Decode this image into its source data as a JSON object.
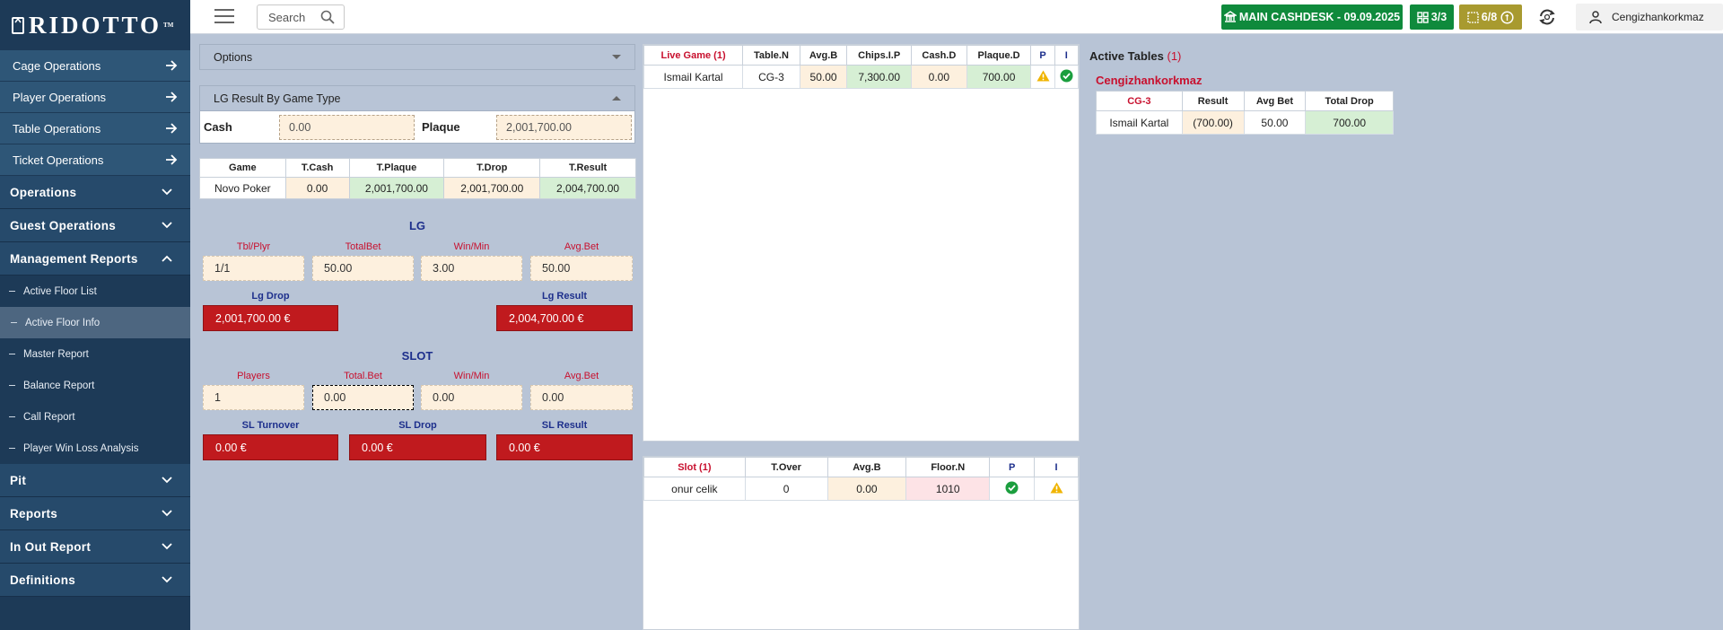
{
  "brand": {
    "name": "RIDOTTO",
    "tm": "TM"
  },
  "sidebar": {
    "sub_ops": [
      {
        "label": "Cage Operations"
      },
      {
        "label": "Player Operations"
      },
      {
        "label": "Table Operations"
      },
      {
        "label": "Ticket Operations"
      }
    ],
    "groups_top": [
      {
        "label": "Operations"
      },
      {
        "label": "Guest Operations"
      },
      {
        "label": "Management Reports"
      }
    ],
    "mgmt_items": [
      {
        "label": "Active Floor List"
      },
      {
        "label": "Active Floor Info"
      },
      {
        "label": "Master Report"
      },
      {
        "label": "Balance Report"
      },
      {
        "label": "Call Report"
      },
      {
        "label": "Player Win Loss Analysis"
      }
    ],
    "groups_bottom": [
      {
        "label": "Pit"
      },
      {
        "label": "Reports"
      },
      {
        "label": "In Out Report"
      },
      {
        "label": "Definitions"
      }
    ]
  },
  "topbar": {
    "search_placeholder": "Search",
    "cashdesk": "MAIN CASHDESK - 09.09.2025",
    "tables_badge": "3/3",
    "slots_badge": "6/8",
    "username": "Cengizhankorkmaz"
  },
  "options": {
    "label": "Options"
  },
  "lg_by_type": {
    "label": "LG Result By Game Type",
    "cash_label": "Cash",
    "cash_value": "0.00",
    "plaque_label": "Plaque",
    "plaque_value": "2,001,700.00"
  },
  "game_table": {
    "headers": [
      "Game",
      "T.Cash",
      "T.Plaque",
      "T.Drop",
      "T.Result"
    ],
    "rows": [
      [
        "Novo Poker",
        "0.00",
        "2,001,700.00",
        "2,001,700.00",
        "2,004,700.00"
      ]
    ]
  },
  "lg": {
    "title": "LG",
    "labels": [
      "Tbl/Plyr",
      "TotalBet",
      "Win/Min",
      "Avg.Bet"
    ],
    "values": [
      "1/1",
      "50.00",
      "3.00",
      "50.00"
    ],
    "drop_label": "Lg Drop",
    "drop_value": "2,001,700.00 €",
    "result_label": "Lg Result",
    "result_value": "2,004,700.00 €"
  },
  "slot": {
    "title": "SLOT",
    "labels": [
      "Players",
      "Total.Bet",
      "Win/Min",
      "Avg.Bet"
    ],
    "values": [
      "1",
      "0.00",
      "0.00",
      "0.00"
    ],
    "turnover_label": "SL Turnover",
    "turnover_value": "0.00 €",
    "drop_label": "SL Drop",
    "drop_value": "0.00 €",
    "result_label": "SL Result",
    "result_value": "0.00 €"
  },
  "live_game": {
    "headers": [
      "Live Game (1)",
      "Table.N",
      "Avg.B",
      "Chips.I.P",
      "Cash.D",
      "Plaque.D",
      "P",
      "I"
    ],
    "rows": [
      [
        "Ismail Kartal",
        "CG-3",
        "50.00",
        "7,300.00",
        "0.00",
        "700.00"
      ]
    ]
  },
  "slot_table": {
    "headers": [
      "Slot (1)",
      "T.Over",
      "Avg.B",
      "Floor.N",
      "P",
      "I"
    ],
    "rows": [
      [
        "onur celik",
        "0",
        "0.00",
        "1010"
      ]
    ]
  },
  "active_tables": {
    "title": "Active Tables",
    "count": "(1)",
    "user": "Cengizhankorkmaz",
    "headers": [
      "CG-3",
      "Result",
      "Avg Bet",
      "Total Drop"
    ],
    "rows": [
      [
        "Ismail Kartal",
        "(700.00)",
        "50.00",
        "700.00"
      ]
    ]
  },
  "colors": {
    "sidebar": "#1d3a57",
    "accent_green": "#0f8a3c",
    "accent_olive": "#a89a2f",
    "alert_red": "#c01a1e",
    "label_red": "#c8102e",
    "label_navy": "#1d2f8c"
  },
  "icons": [
    "menu-icon",
    "search-icon",
    "cashdesk-icon",
    "table-grid-icon",
    "slot-machine-icon",
    "refresh-icon",
    "user-icon",
    "arrow-right-icon",
    "chevron-down-icon",
    "chevron-up-icon",
    "warning-icon",
    "check-circle-icon"
  ]
}
